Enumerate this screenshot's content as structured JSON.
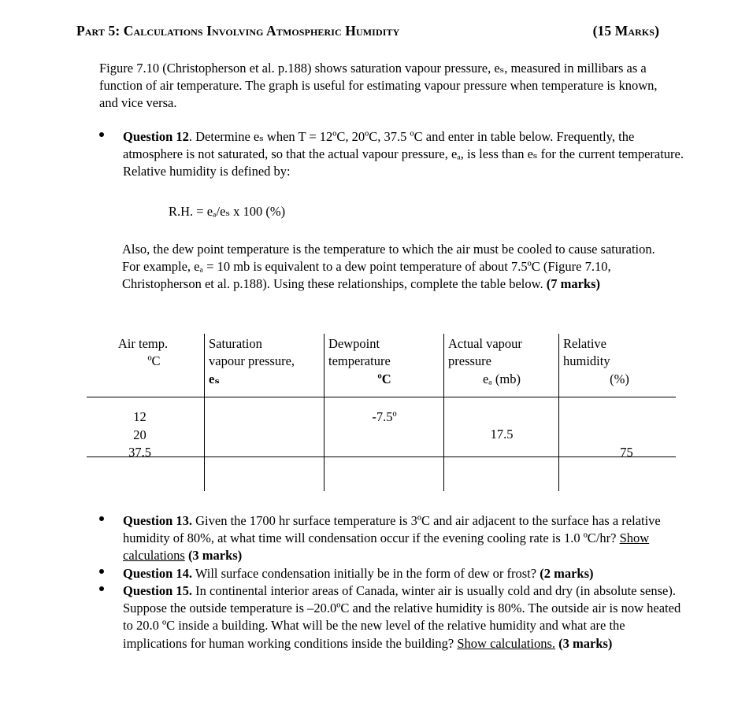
{
  "heading": {
    "title": "Part 5: Calculations Involving Atmospheric Humidity",
    "marks": "(15 Marks)"
  },
  "intro_paragraph": "Figure 7.10 (Christopherson et al. p.188) shows saturation vapour pressure, eₛ, measured in millibars as a function of air temperature. The graph is useful for estimating vapour pressure when temperature is known, and vice versa.",
  "question12": {
    "label": "Question 12",
    "text": ". Determine eₛ when T = 12ºC, 20ºC, 37.5 ºC   and enter in table below. Frequently, the atmosphere is not saturated, so that the actual vapour pressure, eₐ, is less than eₛ for the current temperature.  Relative humidity is defined by:"
  },
  "formula": "R.H. = eₐ/eₛ x 100 (%)",
  "also_paragraph": {
    "text": "Also, the dew point temperature is the temperature to which the air must be cooled to cause saturation.  For example, eₐ = 10 mb is equivalent to a dew point temperature of about 7.5ºC (Figure 7.10, Christopherson et al. p.188).  Using these relationships, complete the table below. ",
    "marks": "(7 marks)"
  },
  "table": {
    "headers": [
      {
        "line1": "Air temp.",
        "line2": "ºC",
        "line3": ""
      },
      {
        "line1": "Saturation",
        "line2": "vapour pressure,",
        "line3": "eₛ"
      },
      {
        "line1": "Dewpoint",
        "line2": "temperature",
        "line3": "ºC"
      },
      {
        "line1": "Actual vapour",
        "line2": "pressure",
        "line3": "eₐ  (mb)"
      },
      {
        "line1": "Relative",
        "line2": "humidity",
        "line3": "(%)"
      }
    ],
    "air_temp_values": [
      "12",
      "20",
      "37.5"
    ],
    "saturation_vapour_pressure_values": [
      "",
      "",
      ""
    ],
    "dewpoint_values": [
      "-7.5º",
      "",
      ""
    ],
    "actual_vapour_pressure_values": [
      "",
      "17.5",
      ""
    ],
    "relative_humidity_values": [
      "",
      "",
      "75"
    ]
  },
  "question13": {
    "label": "Question 13.",
    "text_a": " Given the 1700 hr surface temperature is 3ºC and air adjacent to the surface has a relative humidity of 80%, at what time will condensation occur if the evening cooling rate is 1.0 ºC/hr?  ",
    "underlined": "Show calculations",
    "text_b": " ",
    "marks": "(3 marks)"
  },
  "question14": {
    "label": "Question 14.",
    "text": " Will surface condensation initially be in the form of dew or frost? ",
    "marks": "(2 marks)"
  },
  "question15": {
    "label": "Question 15.",
    "text_a": " In continental interior areas of Canada, winter air is usually cold and dry (in absolute sense).  Suppose the outside temperature is –20.0ºC and the relative humidity is 80%.  The outside air is now heated to 20.0 ºC inside a building.  What will be the new level of the relative humidity and what are the implications for human working conditions inside the building?  ",
    "underlined": "Show calculations.",
    "text_b": " ",
    "marks": "(3 marks)"
  },
  "colors": {
    "text": "#000000",
    "page_background": "#ffffff",
    "rule": "#000000"
  }
}
